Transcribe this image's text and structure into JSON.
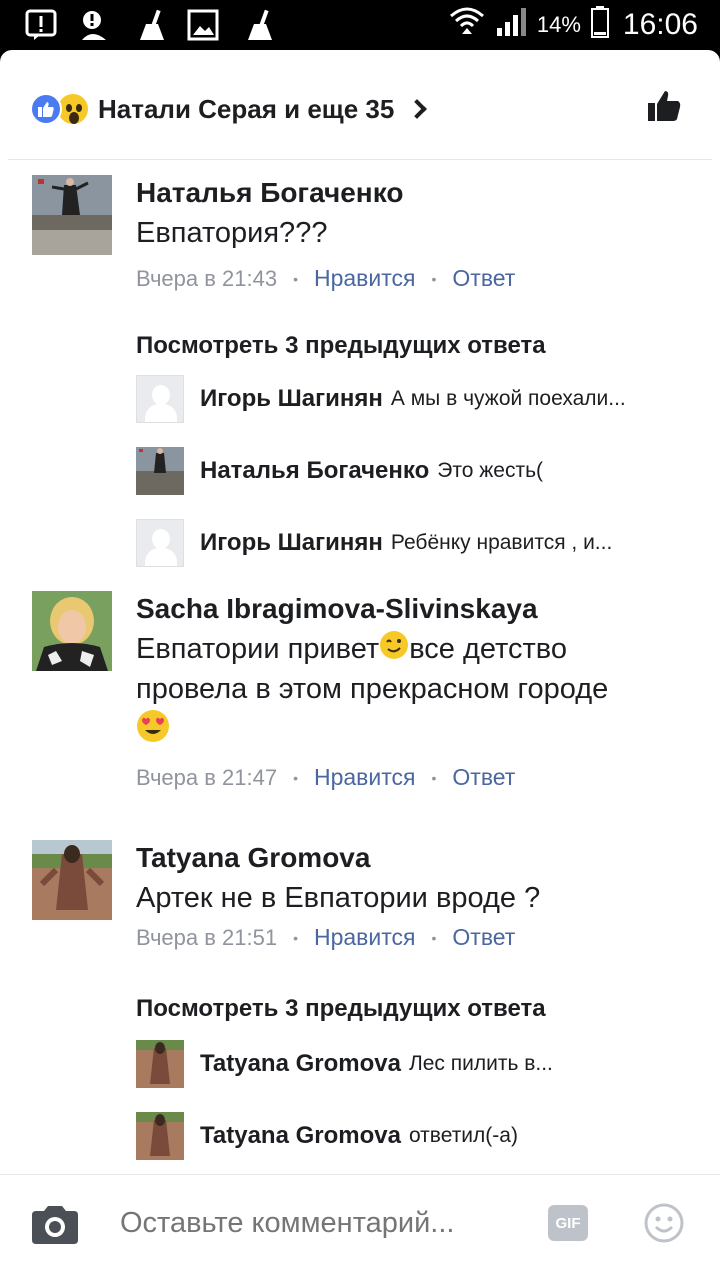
{
  "status_bar": {
    "battery": "14%",
    "time": "16:06"
  },
  "header": {
    "title": "Натали Серая и еще 35"
  },
  "comments": [
    {
      "name": "Наталья Богаченко",
      "text": "Евпатория???",
      "time": "Вчера в 21:43",
      "like": "Нравится",
      "reply": "Ответ"
    },
    {
      "name": "Sacha Ibragimova-Slivinskaya",
      "text_line1_a": "Евпатории привет",
      "text_line1_b": "все детство",
      "text_line2": "провела в этом прекрасном городе",
      "time": "Вчера в 21:47",
      "like": "Нравится",
      "reply": "Ответ"
    },
    {
      "name": "Tatyana Gromova",
      "text": "Артек не в Евпатории вроде ?",
      "time": "Вчера в 21:51",
      "like": "Нравится",
      "reply": "Ответ"
    }
  ],
  "thread1": {
    "prev": "Посмотреть 3 предыдущих ответа",
    "replies": [
      {
        "name": "Игорь Шагинян",
        "text": "А мы в чужой поехали..."
      },
      {
        "name": "Наталья Богаченко",
        "text": "Это жесть("
      },
      {
        "name": "Игорь Шагинян",
        "text": "Ребёнку нравится , и..."
      }
    ]
  },
  "thread3": {
    "prev": "Посмотреть 3 предыдущих ответа",
    "replies": [
      {
        "name": "Tatyana Gromova",
        "text": "Лес пилить в..."
      },
      {
        "name": "Tatyana Gromova",
        "text": "ответил(-а)"
      }
    ]
  },
  "composer": {
    "placeholder": "Оставьте комментарий...",
    "gif": "GIF"
  },
  "colors": {
    "link": "#4b67a1",
    "meta": "#90949c",
    "like_blue": "#4a7bf0"
  }
}
